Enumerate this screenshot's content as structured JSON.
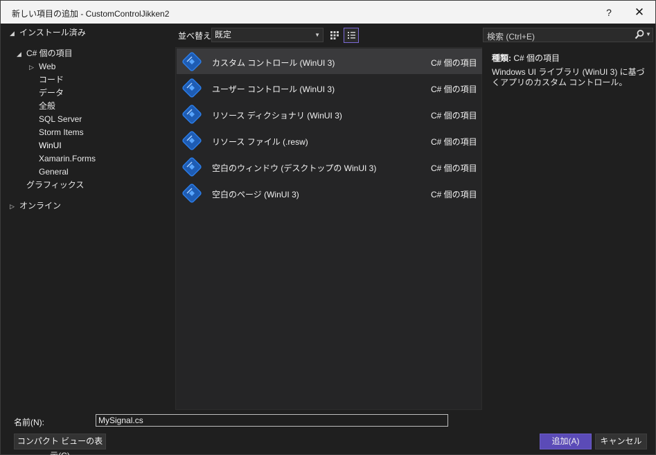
{
  "window": {
    "title": "新しい項目の追加 - CustomControlJikken2",
    "help_label": "?",
    "close_label": "✕"
  },
  "tree": {
    "installed": "インストール済み",
    "csharp": "C# 個の項目",
    "children": [
      "Web",
      "コード",
      "データ",
      "全般",
      "SQL Server",
      "Storm Items",
      "WinUI",
      "Xamarin.Forms",
      "General"
    ],
    "graphics": "グラフィックス",
    "online": "オンライン",
    "selected": "WinUI"
  },
  "toolbar": {
    "sort_label": "並べ替え:",
    "sort_value": "既定",
    "view_mode": "list"
  },
  "items": [
    {
      "name": "カスタム コントロール (WinUI 3)",
      "category": "C# 個の項目",
      "icon": "winui-icon"
    },
    {
      "name": "ユーザー コントロール (WinUI 3)",
      "category": "C# 個の項目",
      "icon": "winui-icon"
    },
    {
      "name": "リソース ディクショナリ (WinUI 3)",
      "category": "C# 個の項目",
      "icon": "winui-icon"
    },
    {
      "name": "リソース ファイル (.resw)",
      "category": "C# 個の項目",
      "icon": "winui-icon"
    },
    {
      "name": "空白のウィンドウ (デスクトップの WinUI 3)",
      "category": "C# 個の項目",
      "icon": "winui-icon"
    },
    {
      "name": "空白のページ (WinUI 3)",
      "category": "C# 個の項目",
      "icon": "winui-icon"
    }
  ],
  "selected_item_index": 0,
  "search": {
    "placeholder": "検索 (Ctrl+E)"
  },
  "details": {
    "type_label": "種類:",
    "type_value": "C# 個の項目",
    "description": "Windows UI ライブラリ (WinUI 3) に基づくアプリのカスタム コントロール。"
  },
  "footer": {
    "name_label": "名前(N):",
    "name_value": "MySignal.cs",
    "compact_view_label": "コンパクト ビューの表示(C)",
    "add_label": "追加(A)",
    "cancel_label": "キャンセル"
  },
  "colors": {
    "accent": "#5b4bb7",
    "background": "#1f1f1f",
    "list_background": "#252526",
    "selection": "#3a3a3c",
    "titlebar": "#f3f3f3"
  }
}
